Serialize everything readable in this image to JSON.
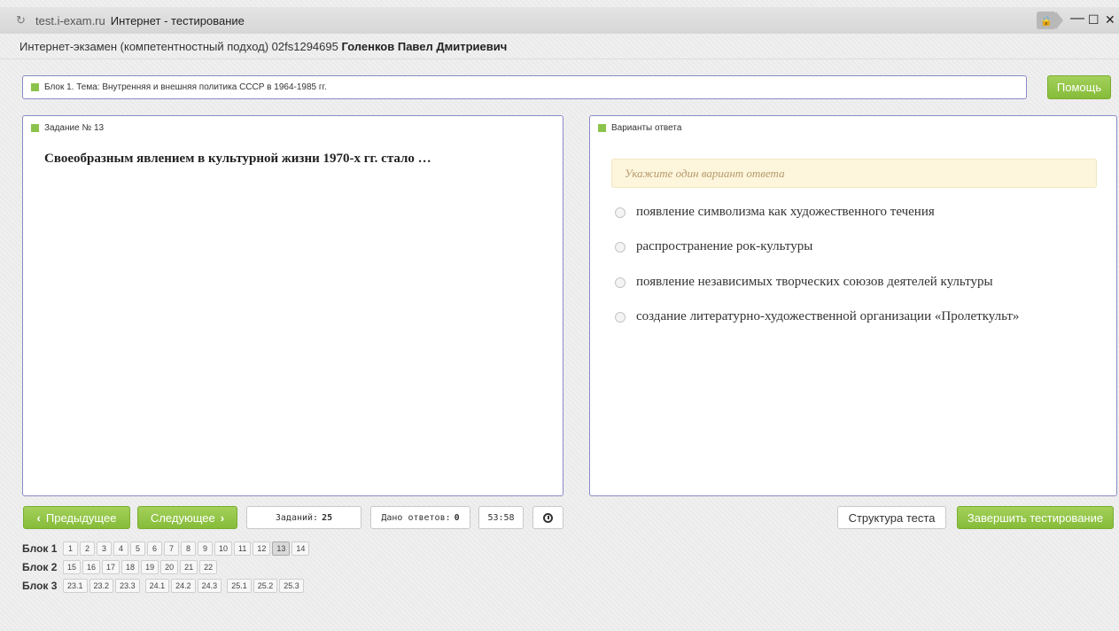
{
  "window": {
    "domain": "test.i-exam.ru",
    "page_title": "Интернет - тестирование",
    "reload_icon": "reload-icon",
    "lock_icon": "lock-icon",
    "minimize": "—",
    "maximize": "☐",
    "close": "✕"
  },
  "header": {
    "exam_info": "Интернет-экзамен (компетентностный подход) 02fs1294695",
    "student_name": "Голенков Павел Дмитриевич"
  },
  "block_bar": {
    "text": "Блок 1. Тема: Внутренняя и внешняя политика СССР в 1964-1985 гг."
  },
  "help_label": "Помощь",
  "question": {
    "title": "Задание № 13",
    "text": "Своеобразным явлением в культурной жизни 1970-х гг. стало …"
  },
  "answers": {
    "title": "Варианты ответа",
    "hint": "Укажите один вариант ответа",
    "options": [
      "появление символизма как художественного течения",
      "распространение рок-культуры",
      "появление независимых творческих союзов деятелей культуры",
      "создание литературно-художественной организации «Пролеткульт»"
    ]
  },
  "controls": {
    "prev_label": "Предыдущее",
    "next_label": "Следующее",
    "tasks_label": "Заданий:",
    "tasks_count": "25",
    "answered_label": "Дано ответов:",
    "answered_count": "0",
    "timer": "53:58",
    "structure_label": "Структура теста",
    "finish_label": "Завершить тестирование"
  },
  "navigation": {
    "block1": {
      "label": "Блок 1",
      "groups": [
        [
          "1",
          "2",
          "3",
          "4",
          "5",
          "6",
          "7",
          "8",
          "9",
          "10",
          "11",
          "12",
          "13",
          "14"
        ]
      ],
      "active": "13"
    },
    "block2": {
      "label": "Блок 2",
      "groups": [
        [
          "15",
          "16",
          "17",
          "18",
          "19",
          "20",
          "21",
          "22"
        ]
      ]
    },
    "block3": {
      "label": "Блок 3",
      "groups": [
        [
          "23.1",
          "23.2",
          "23.3"
        ],
        [
          "24.1",
          "24.2",
          "24.3"
        ],
        [
          "25.1",
          "25.2",
          "25.3"
        ]
      ]
    }
  },
  "colors": {
    "accent_green": "#8bc34a",
    "panel_border": "#8a8ac8",
    "hint_bg": "#fdf5dc"
  }
}
